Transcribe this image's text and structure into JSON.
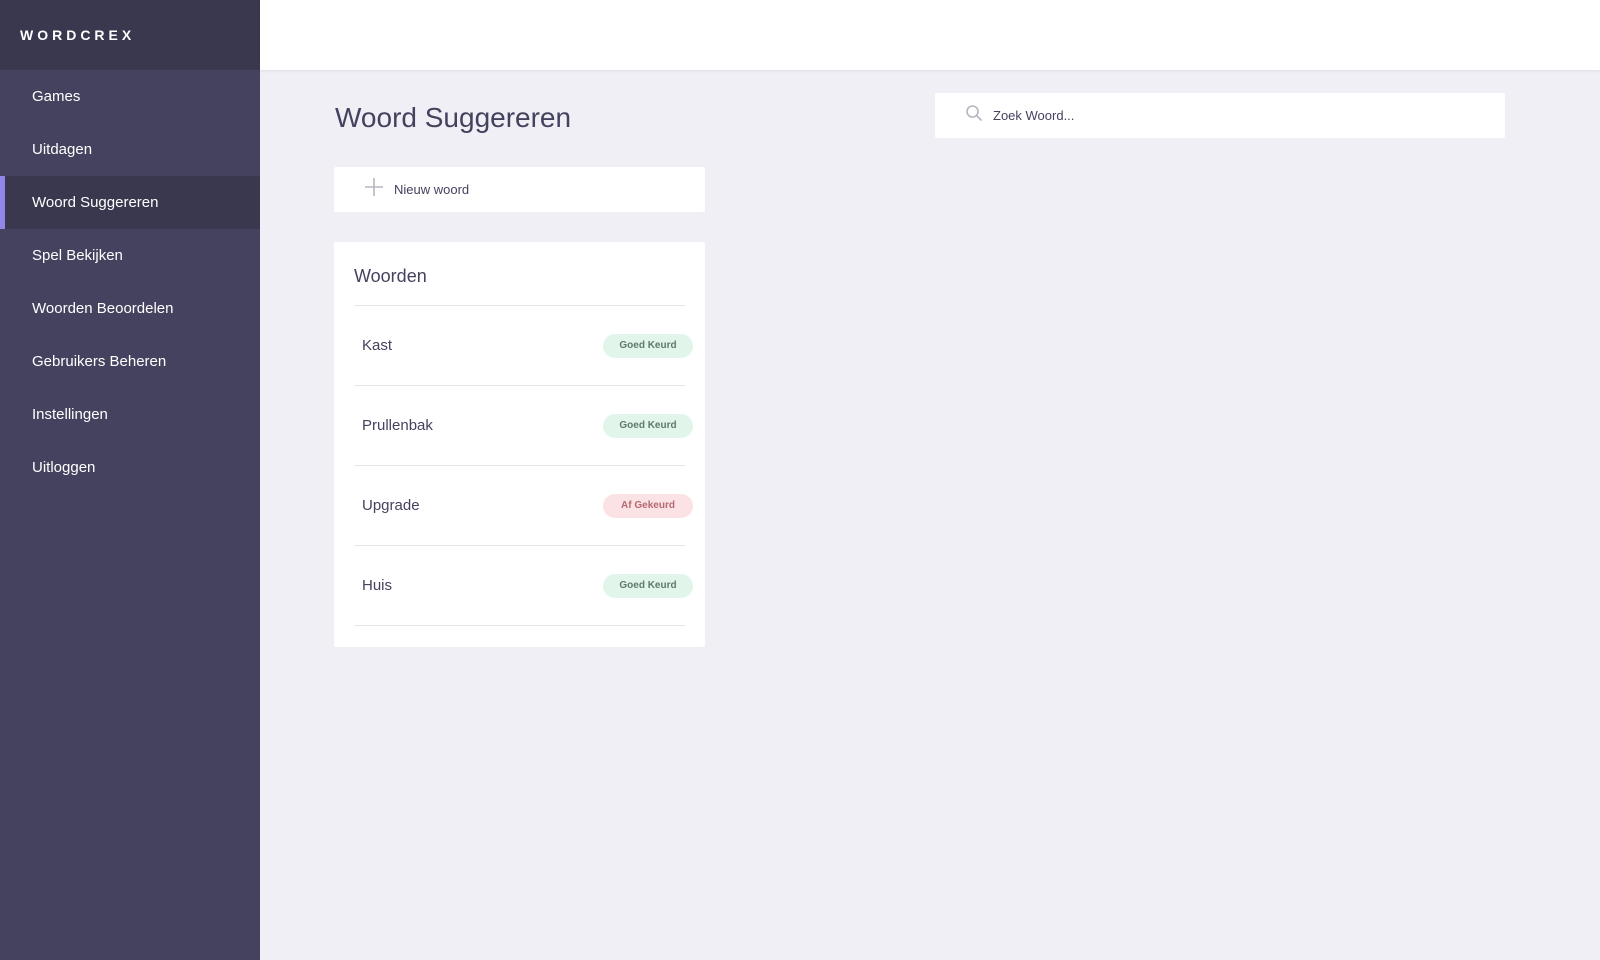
{
  "brand": {
    "name": "WORDCREX"
  },
  "sidebar": {
    "items": [
      {
        "label": "Games",
        "active": false
      },
      {
        "label": "Uitdagen",
        "active": false
      },
      {
        "label": "Woord Suggereren",
        "active": true
      },
      {
        "label": "Spel Bekijken",
        "active": false
      },
      {
        "label": "Woorden Beoordelen",
        "active": false
      },
      {
        "label": "Gebruikers Beheren",
        "active": false
      },
      {
        "label": "Instellingen",
        "active": false
      },
      {
        "label": "Uitloggen",
        "active": false
      }
    ]
  },
  "main": {
    "title": "Woord Suggereren",
    "search": {
      "placeholder": "Zoek Woord...",
      "value": "",
      "icon": "search-icon"
    },
    "new_word": {
      "label": "Nieuw woord",
      "icon": "plus-icon"
    },
    "words_card": {
      "title": "Woorden",
      "rows": [
        {
          "word": "Kast",
          "status": "Goed Keurd",
          "status_type": "approved"
        },
        {
          "word": "Prullenbak",
          "status": "Goed Keurd",
          "status_type": "approved"
        },
        {
          "word": "Upgrade",
          "status": "Af Gekeurd",
          "status_type": "rejected"
        },
        {
          "word": "Huis",
          "status": "Goed Keurd",
          "status_type": "approved"
        }
      ]
    }
  },
  "colors": {
    "sidebar_bg": "#44425e",
    "sidebar_active_bg": "#3a384f",
    "accent": "#8f86e8",
    "approved_bg": "#e2f5ea",
    "rejected_bg": "#fbe3e5"
  }
}
